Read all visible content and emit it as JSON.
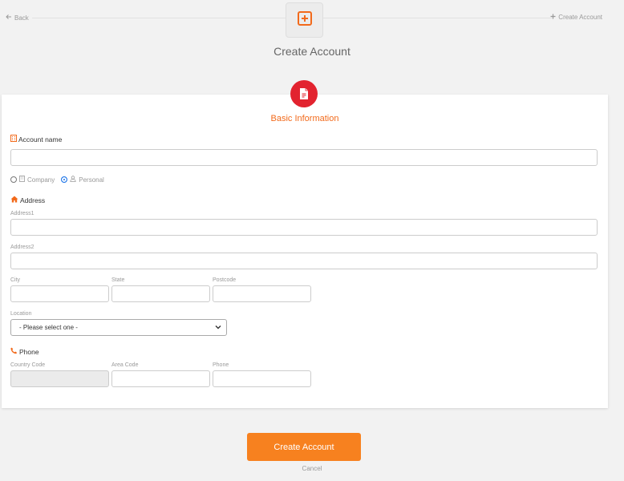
{
  "nav": {
    "back_label": "Back",
    "create_label": "Create Account"
  },
  "page": {
    "title": "Create Account"
  },
  "form": {
    "section_title": "Basic Information",
    "account_name": {
      "label": "Account name",
      "value": ""
    },
    "account_type": {
      "options": [
        {
          "label": "Company",
          "checked": false
        },
        {
          "label": "Personal",
          "checked": true
        }
      ]
    },
    "address": {
      "heading": "Address",
      "address1_label": "Address1",
      "address2_label": "Address2",
      "city_label": "City",
      "state_label": "State",
      "postcode_label": "Postcode",
      "location_label": "Location",
      "location_selected": "- Please select one -"
    },
    "phone": {
      "heading": "Phone",
      "country_code_label": "Country Code",
      "area_code_label": "Area Code",
      "phone_label": "Phone"
    }
  },
  "actions": {
    "submit_label": "Create Account",
    "cancel_label": "Cancel"
  },
  "colors": {
    "accent": "#f26a1b",
    "button": "#f7811f",
    "card_icon": "#e2232f",
    "radio_selected": "#1a73e8"
  }
}
